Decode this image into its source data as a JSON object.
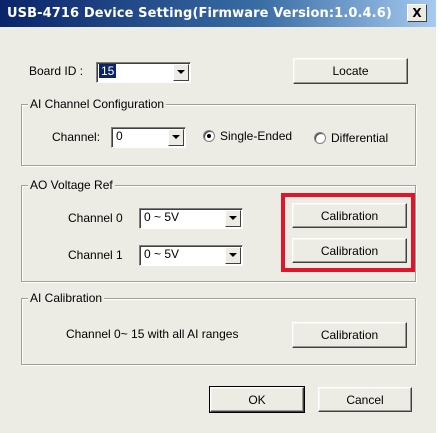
{
  "window": {
    "title": "USB-4716 Device Setting(Firmware Version:1.0.4.6)",
    "close_label": "X"
  },
  "board": {
    "label": "Board ID :",
    "value": "15",
    "locate_label": "Locate"
  },
  "ai_channel": {
    "group_title": "AI Channel Configuration",
    "channel_label": "Channel:",
    "channel_value": "0",
    "single_ended_label": "Single-Ended",
    "differential_label": "Differential",
    "selected_mode": "Single-Ended"
  },
  "ao_voltage": {
    "group_title": "AO Voltage Ref",
    "rows": [
      {
        "channel_label": "Channel 0",
        "range_value": "0 ~ 5V",
        "button_label": "Calibration"
      },
      {
        "channel_label": "Channel 1",
        "range_value": "0 ~ 5V",
        "button_label": "Calibration"
      }
    ],
    "highlight_color": "#e0142b"
  },
  "ai_calibration": {
    "group_title": "AI Calibration",
    "description": "Channel 0~ 15 with all AI ranges",
    "button_label": "Calibration"
  },
  "footer": {
    "ok_label": "OK",
    "cancel_label": "Cancel"
  }
}
